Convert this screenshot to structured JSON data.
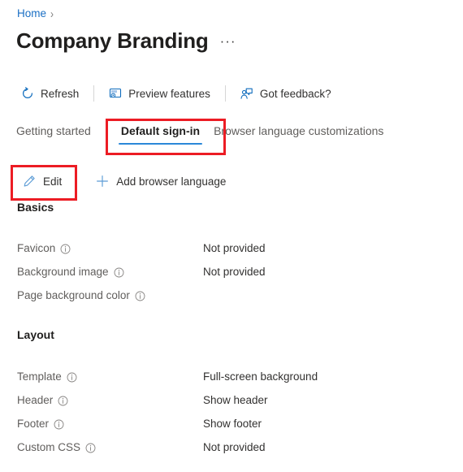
{
  "breadcrumb": {
    "items": [
      {
        "label": "Home",
        "icon": "none"
      }
    ],
    "separator": "›"
  },
  "header": {
    "title": "Company Branding",
    "more_menu": "···",
    "more_menu_name": "more-options"
  },
  "commandbar": {
    "items": [
      {
        "label": "Refresh",
        "icon": "refresh-icon"
      },
      {
        "label": "Preview features",
        "icon": "preview-features-icon"
      },
      {
        "label": "Got feedback?",
        "icon": "feedback-icon"
      }
    ]
  },
  "tabs": [
    {
      "label": "Getting started",
      "active": false
    },
    {
      "label": "Default sign-in",
      "active": true
    },
    {
      "label": "Browser language customizations",
      "active": false
    }
  ],
  "actionbar": {
    "items": [
      {
        "label": "Edit",
        "icon": "pencil-icon"
      },
      {
        "label": "Add browser language",
        "icon": "plus-icon"
      }
    ]
  },
  "sections": [
    {
      "heading": "Basics",
      "rows": [
        {
          "label": "Favicon",
          "value": "Not provided",
          "info": true
        },
        {
          "label": "Background image",
          "value": "Not provided",
          "info": true
        },
        {
          "label": "Page background color",
          "value": "",
          "info": true
        }
      ]
    },
    {
      "heading": "Layout",
      "rows": [
        {
          "label": "Template",
          "value": "Full-screen background",
          "info": true
        },
        {
          "label": "Header",
          "value": "Show header",
          "info": true
        },
        {
          "label": "Footer",
          "value": "Show footer",
          "info": true
        },
        {
          "label": "Custom CSS",
          "value": "Not provided",
          "info": true
        }
      ]
    }
  ],
  "annotations": [
    {
      "name": "highlight-default-signin-tab",
      "color": "#ec1c24"
    },
    {
      "name": "highlight-edit-button",
      "color": "#ec1c24"
    }
  ],
  "colors": {
    "link": "#1a6fc4",
    "accent": "#2b88d8",
    "icon_blue": "#0f6cbd",
    "text_primary": "#201f1e",
    "text_secondary": "#605e5c",
    "annotation_red": "#ec1c24"
  }
}
